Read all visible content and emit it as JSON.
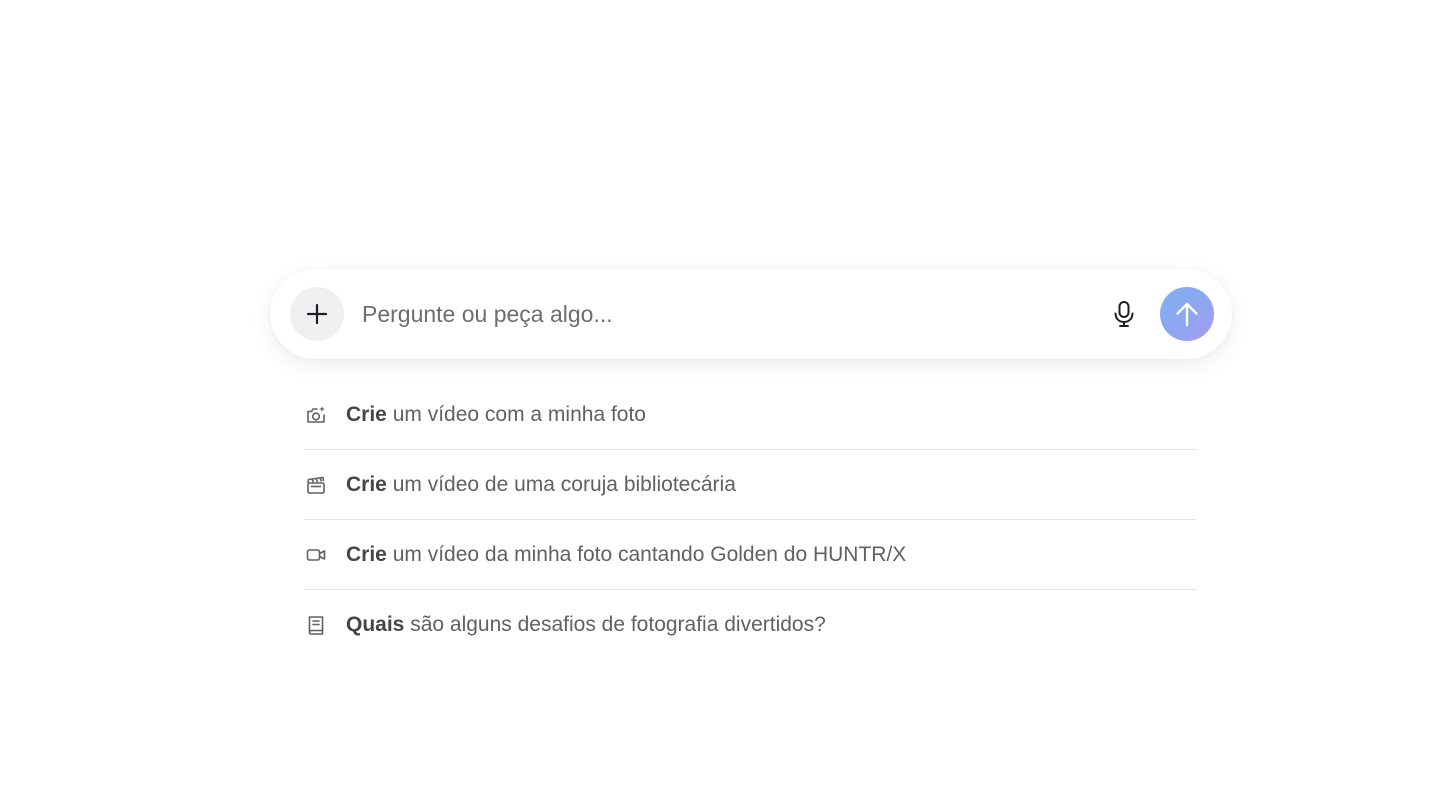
{
  "composer": {
    "placeholder": "Pergunte ou peça algo...",
    "value": "",
    "plus_icon": "plus-icon",
    "mic_icon": "microphone-icon",
    "send_icon": "arrow-up-icon",
    "send_gradient": [
      "#7fb0f2",
      "#a69bef"
    ]
  },
  "suggestions": [
    {
      "icon": "camera-sparkle-icon",
      "bold": "Crie",
      "rest": " um vídeo com a minha foto"
    },
    {
      "icon": "clapperboard-icon",
      "bold": "Crie",
      "rest": " um vídeo de uma coruja bibliotecária"
    },
    {
      "icon": "video-camera-icon",
      "bold": "Crie",
      "rest": " um vídeo da minha foto cantando Golden do HUNTR/X"
    },
    {
      "icon": "book-icon",
      "bold": "Quais",
      "rest": " são alguns desafios de fotografia divertidos?"
    }
  ]
}
